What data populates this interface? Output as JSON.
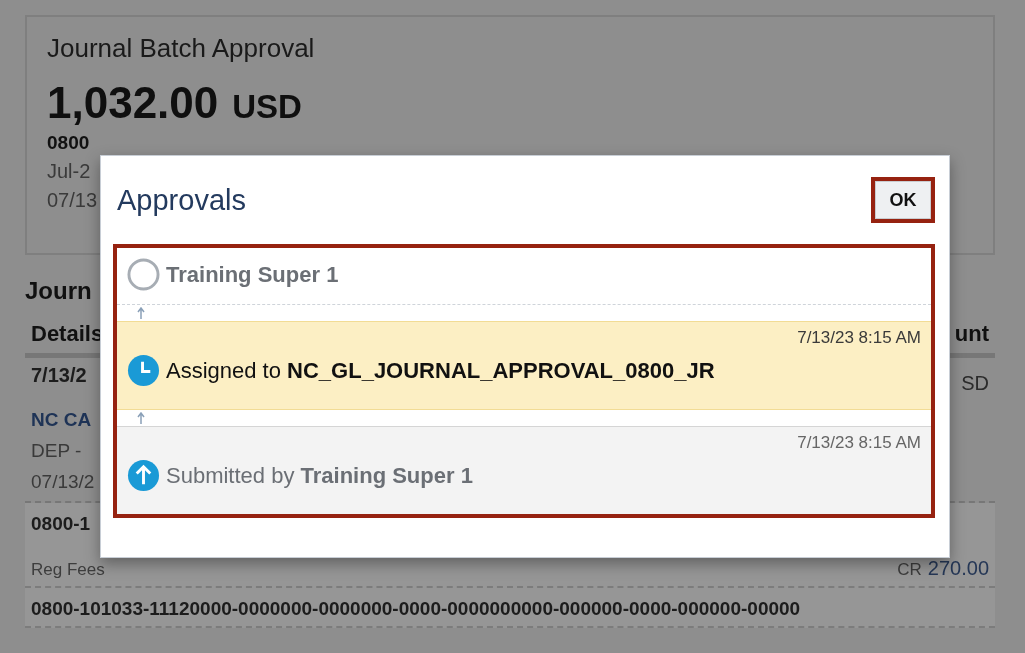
{
  "page": {
    "title": "Journal Batch Approval",
    "amount": "1,032.00",
    "currency": "USD",
    "description": "0800",
    "period": "Jul-2",
    "date": "07/13"
  },
  "section_title": "Journ",
  "table": {
    "columns": [
      "Details",
      "unt"
    ],
    "summary": {
      "date": "7/13/2",
      "amount": "SD"
    },
    "entry": {
      "name": "NC CA",
      "type": "DEP -",
      "date": "07/13/2"
    },
    "lines": [
      {
        "account": "0800-1",
        "description": "Reg Fees",
        "side": "CR",
        "amount": "270.00"
      },
      {
        "account": "0800-101033-11120000-0000000-0000000-0000-0000000000-000000-0000-000000-00000"
      }
    ]
  },
  "dialog": {
    "title": "Approvals",
    "ok": "OK",
    "steps": [
      {
        "kind": "pending",
        "name": "Training Super 1"
      },
      {
        "kind": "assigned",
        "prefix": "Assigned to",
        "name": "NC_GL_JOURNAL_APPROVAL_0800_JR",
        "time": "7/13/23 8:15 AM"
      },
      {
        "kind": "submitted",
        "prefix": "Submitted by",
        "name": "Training Super 1",
        "time": "7/13/23 8:15 AM"
      }
    ]
  }
}
